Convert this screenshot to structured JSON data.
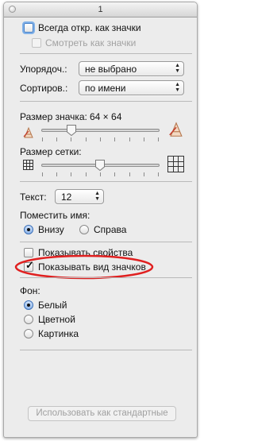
{
  "window": {
    "title": "1"
  },
  "view_options": {
    "always_open_label": "Всегда откр. как значки",
    "browse_label": "Смотреть как значки"
  },
  "arrange": {
    "label": "Упорядоч.:",
    "value": "не выбрано"
  },
  "sort": {
    "label": "Сортиров.:",
    "value": "по имени"
  },
  "icon_size": {
    "label": "Размер значка:",
    "value_text": "64 × 64",
    "level": 0.12
  },
  "grid_spacing": {
    "label": "Размер сетки:",
    "level": 0.5
  },
  "text_size": {
    "label": "Текст:",
    "value": "12"
  },
  "label_position": {
    "label": "Поместить имя:",
    "bottom": "Внизу",
    "right": "Справа",
    "selected": "Внизу"
  },
  "show_item_info": {
    "label": "Показывать свойства",
    "checked": false
  },
  "show_icon_preview": {
    "label": "Показывать вид значков",
    "checked": true
  },
  "background": {
    "label": "Фон:",
    "options": [
      "Белый",
      "Цветной",
      "Картинка"
    ],
    "selected": "Белый"
  },
  "use_as_defaults_label": "Использовать как стандартные",
  "colors": {
    "highlight_ellipse": "#e02020",
    "radio_selected": "#8fb6e9"
  }
}
